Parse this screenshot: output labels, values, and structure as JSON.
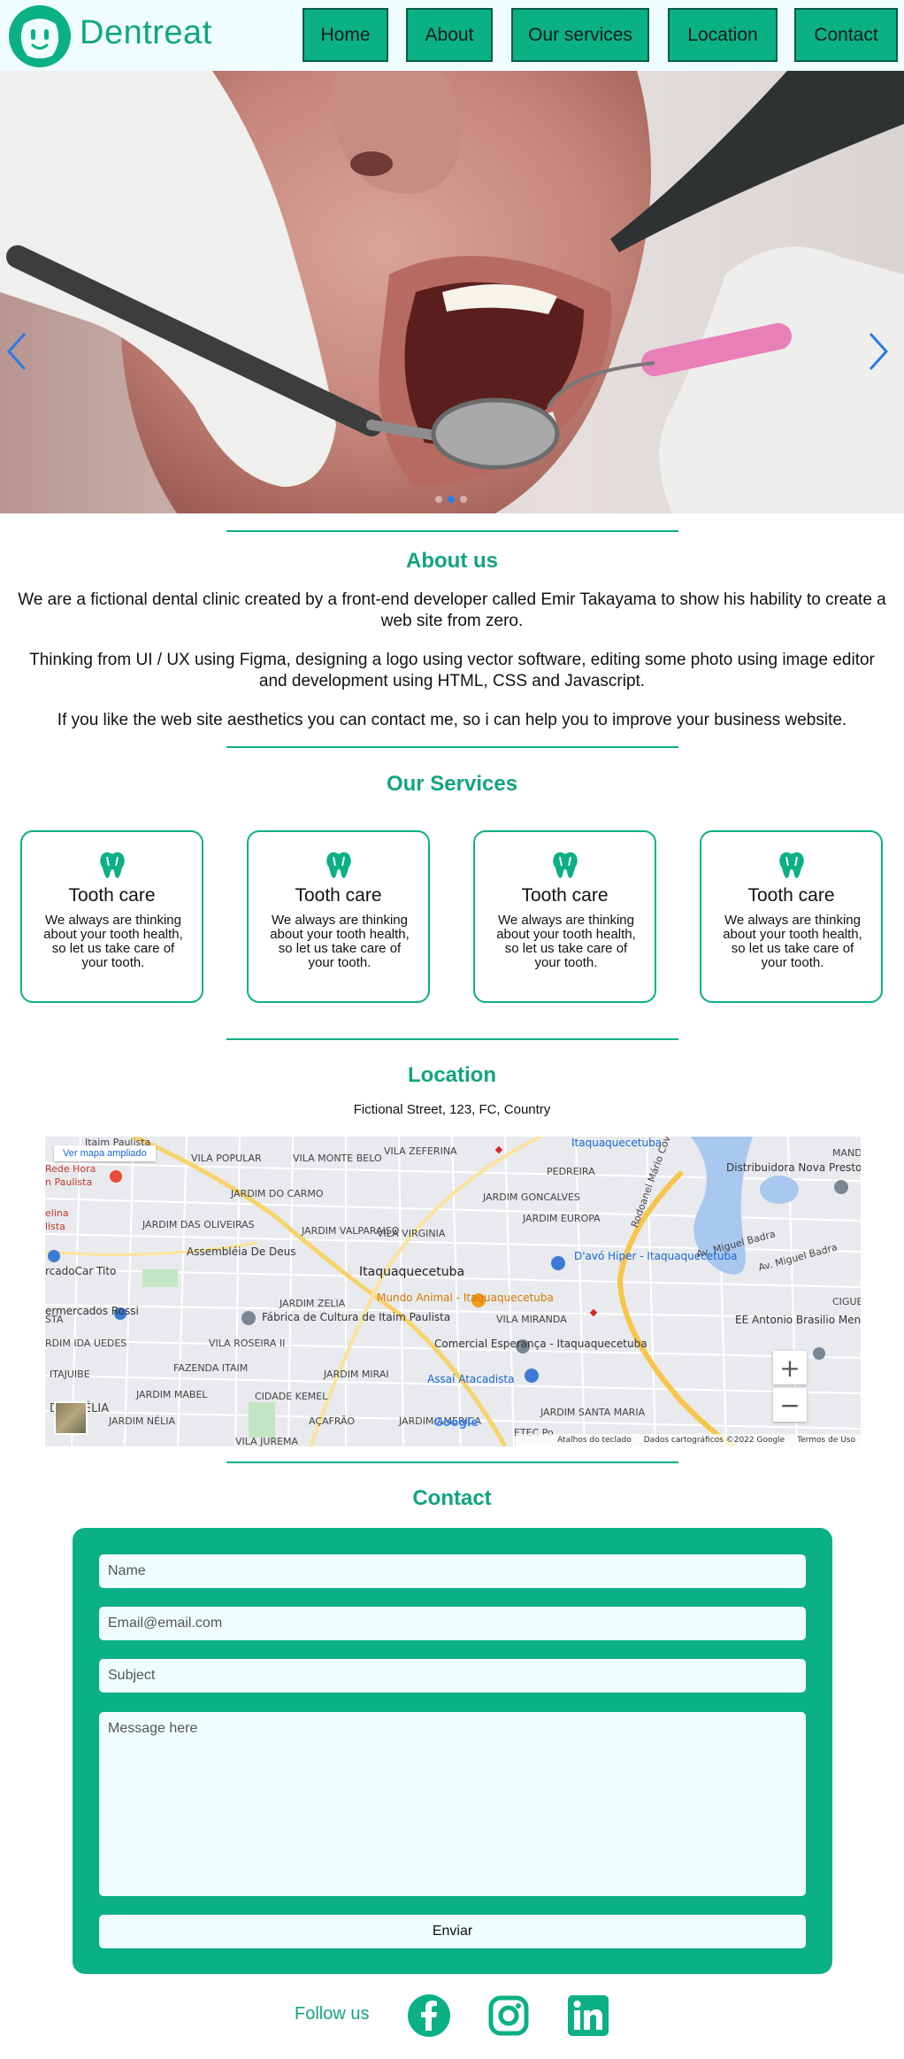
{
  "header": {
    "brand": "Dentreat",
    "nav": [
      "Home",
      "About",
      "Our services",
      "Location",
      "Contact"
    ]
  },
  "hero": {
    "slide_count": 3,
    "active_slide": 2
  },
  "about": {
    "title": "About us",
    "paragraphs": [
      "We are a fictional dental clinic created by a front-end developer called Emir Takayama to show his hability to create a web site from zero.",
      "Thinking from UI / UX using Figma, designing a logo using vector software, editing some photo using image editor and development using HTML, CSS and Javascript.",
      "If you like the web site aesthetics you can contact me, so i can help you to improve your business website."
    ]
  },
  "services": {
    "title": "Our Services",
    "cards": [
      {
        "title": "Tooth care",
        "text": "We always are thinking about your tooth health, so let us take care of your tooth."
      },
      {
        "title": "Tooth care",
        "text": "We always are thinking about your tooth health, so let us take care of your tooth."
      },
      {
        "title": "Tooth care",
        "text": "We always are thinking about your tooth health, so let us take care of your tooth."
      },
      {
        "title": "Tooth care",
        "text": "We always are thinking about your tooth health, so let us take care of your tooth."
      }
    ]
  },
  "location": {
    "title": "Location",
    "address": "Fictional Street, 123, FC, Country",
    "map": {
      "link": "Ver mapa ampliado",
      "labels": [
        "Itaim Paulista",
        "Rede Hora",
        "n Paulista",
        "elina",
        "lista",
        "VILA POPULAR",
        "VILA MONTE BELO",
        "VILA ZEFERINA",
        "Itaquaquecetuba",
        "PEDREIRA",
        "Distribuidora Nova Presto",
        "JARDIM DO CARMO",
        "JARDIM GONCALVES",
        "JARDIM EUROPA",
        "JARDIM DAS OLIVEIRAS",
        "JARDIM VALPARAISO",
        "VILA VIRGINIA",
        "Assembléia De Deus",
        "D'avó Hiper - Itaquaquecetuba",
        "Av. Miguel Badra",
        "rcadoCar Tito",
        "Itaquaquecetuba",
        "Mundo Animal - Itaquaquecetuba",
        "ermercados Rossi",
        "JARDIM ZELIA",
        "Fábrica de Cultura de Itaim Paulista",
        "VILA MIRANDA",
        "EE Antonio Brasilio Menezes da Fonseca Prof",
        "STA",
        "VILA ROSEIRA II",
        "Comercial Esperança - Itaquaquecetuba",
        "RDIM IDA UEDES",
        "ITAJUIBE",
        "FAZENDA ITAIM",
        "JARDIM MIRAI",
        "Assaí Atacadista",
        "JARDIM MABEL",
        "CIDADE KEMEL",
        "JARDIM SANTA MARIA",
        "DIM NÉLIA",
        "JARDIM NÉLIA",
        "AÇAFRÃO",
        "JARDIM AMERICA",
        "ETEC Po",
        "VILA JUREMA",
        "Rodoanel Mário Covas",
        "Av. Miguel Badra",
        "MAND",
        "CIGUE"
      ],
      "google": "Google",
      "footer": [
        "Atalhos do teclado",
        "Dados cartográficos ©2022 Google",
        "Termos de Uso"
      ],
      "zoom_in": "+",
      "zoom_out": "−"
    }
  },
  "contact": {
    "title": "Contact",
    "name_placeholder": "Name",
    "email_placeholder": "Email@email.com",
    "subject_placeholder": "Subject",
    "message_placeholder": "Message here",
    "send_label": "Enviar"
  },
  "footer": {
    "follow": "Follow us",
    "icons": [
      "facebook-icon",
      "instagram-icon",
      "linkedin-icon"
    ]
  },
  "colors": {
    "accent": "#0bb085",
    "accent_text": "#12a47f",
    "light_bg": "#effdfd",
    "carousel_arrow": "#2a7be4"
  }
}
